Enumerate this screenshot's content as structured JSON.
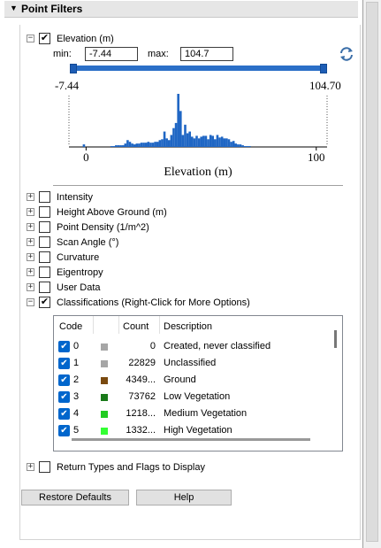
{
  "header": {
    "title": "Point Filters",
    "arrow": "▼"
  },
  "elevation": {
    "label": "Elevation (m)",
    "checked": true,
    "min_label": "min:",
    "max_label": "max:",
    "min_value": "-7.44",
    "max_value": "104.7",
    "slider_min": -7.44,
    "slider_max": 104.7,
    "range_left_label": "-7.44",
    "range_right_label": "104.70",
    "refresh_icon": "refresh-icon"
  },
  "chart_data": {
    "type": "bar",
    "title": "",
    "xlabel": "Elevation (m)",
    "ylabel": "",
    "xticks": [
      "0",
      "100"
    ],
    "xlim": [
      -7.44,
      104.7
    ],
    "bin_start": -7.44,
    "bin_width": 1.0,
    "values": [
      0,
      0,
      0,
      0,
      0,
      0,
      3,
      0,
      0,
      0,
      0,
      0,
      0,
      0,
      0,
      0,
      0,
      0,
      1,
      1,
      2,
      2,
      2,
      2,
      4,
      8,
      6,
      4,
      3,
      4,
      4,
      5,
      5,
      5,
      6,
      5,
      5,
      6,
      6,
      8,
      9,
      18,
      10,
      8,
      14,
      22,
      28,
      62,
      42,
      14,
      26,
      16,
      18,
      12,
      10,
      13,
      10,
      12,
      13,
      13,
      9,
      14,
      13,
      9,
      14,
      11,
      12,
      10,
      10,
      9,
      6,
      7,
      4,
      3,
      3,
      2,
      1,
      1,
      1,
      0,
      0,
      0,
      0,
      0,
      0,
      0,
      0,
      0,
      0,
      0,
      0,
      0,
      0,
      0,
      0,
      0,
      0,
      0,
      0,
      0,
      0,
      0,
      0,
      0,
      0,
      0,
      0,
      0,
      0,
      0,
      0,
      0
    ]
  },
  "filters": [
    {
      "label": "Intensity",
      "checked": false
    },
    {
      "label": "Height Above Ground (m)",
      "checked": false
    },
    {
      "label": "Point Density (1/m^2)",
      "checked": false
    },
    {
      "label": "Scan Angle (°)",
      "checked": false
    },
    {
      "label": "Curvature",
      "checked": false
    },
    {
      "label": "Eigentropy",
      "checked": false
    },
    {
      "label": "User Data",
      "checked": false
    },
    {
      "label": "Classifications (Right-Click for More Options)",
      "checked": true
    }
  ],
  "classification_table": {
    "headers": {
      "code": "Code",
      "count": "Count",
      "description": "Description"
    },
    "rows": [
      {
        "code": "0",
        "color": "#a6a6a6",
        "count": "0",
        "description": "Created, never classified"
      },
      {
        "code": "1",
        "color": "#a6a6a6",
        "count": "22829",
        "description": "Unclassified"
      },
      {
        "code": "2",
        "color": "#7a4a10",
        "count": "4349...",
        "description": "Ground"
      },
      {
        "code": "3",
        "color": "#1a7a1a",
        "count": "73762",
        "description": "Low Vegetation"
      },
      {
        "code": "4",
        "color": "#22cc22",
        "count": "1218...",
        "description": "Medium Vegetation"
      },
      {
        "code": "5",
        "color": "#33ff33",
        "count": "1332...",
        "description": "High Vegetation"
      }
    ]
  },
  "return_types": {
    "label": "Return Types and Flags to Display",
    "checked": false
  },
  "buttons": {
    "restore": "Restore Defaults",
    "help": "Help"
  }
}
